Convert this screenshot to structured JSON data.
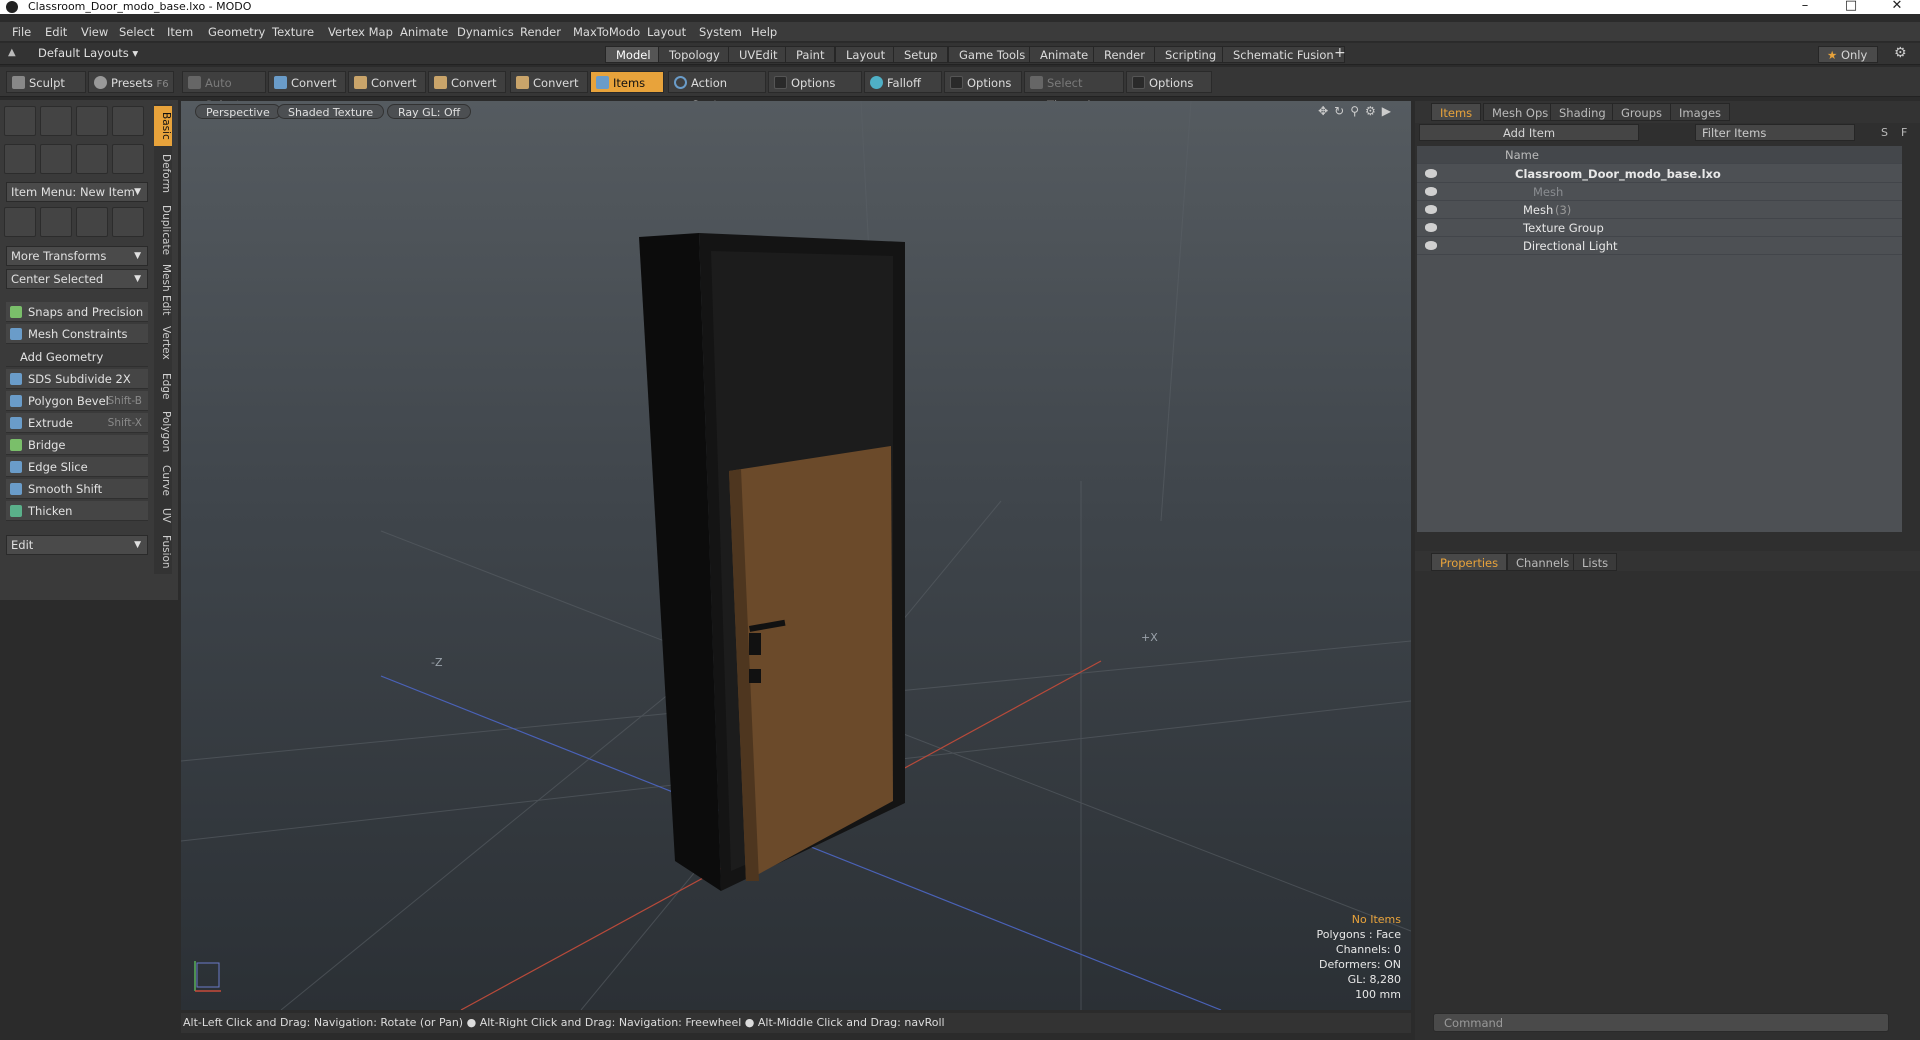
{
  "window": {
    "title": "Classroom_Door_modo_base.lxo - MODO"
  },
  "menu": [
    "File",
    "Edit",
    "View",
    "Select",
    "Item",
    "Geometry",
    "Texture",
    "Vertex Map",
    "Animate",
    "Dynamics",
    "Render",
    "MaxToModo",
    "Layout",
    "System",
    "Help"
  ],
  "layouts": {
    "preset": "Default Layouts",
    "tabs": [
      "Model",
      "Topology",
      "UVEdit",
      "Paint",
      "Layout",
      "Setup",
      "Game Tools",
      "Animate",
      "Render",
      "Scripting",
      "Schematic Fusion"
    ],
    "add": "+",
    "only": "Only"
  },
  "toolbar": {
    "sculpt": "Sculpt",
    "presets": "Presets",
    "presets_key": "F6",
    "auto_select": "Auto Select",
    "convert": "Convert",
    "items": "Items",
    "action_center": "Action Center",
    "options": "Options",
    "falloff": "Falloff",
    "select_through": "Select Through"
  },
  "left": {
    "item_menu": "Item Menu: New Item",
    "more_transforms": "More Transforms",
    "center_selected": "Center Selected",
    "snaps": "Snaps and Precision",
    "mesh_constraints": "Mesh Constraints",
    "add_geometry": "Add Geometry",
    "tools": [
      {
        "label": "SDS Subdivide 2X",
        "key": ""
      },
      {
        "label": "Polygon Bevel",
        "key": "Shift-B"
      },
      {
        "label": "Extrude",
        "key": "Shift-X"
      },
      {
        "label": "Bridge",
        "key": ""
      },
      {
        "label": "Edge Slice",
        "key": ""
      },
      {
        "label": "Smooth Shift",
        "key": ""
      },
      {
        "label": "Thicken",
        "key": ""
      }
    ],
    "edit": "Edit",
    "vtabs": [
      "Basic",
      "Deform",
      "Duplicate",
      "Mesh Edit",
      "Vertex",
      "Edge",
      "Polygon",
      "Curve",
      "UV",
      "Fusion"
    ]
  },
  "viewport": {
    "view": "Perspective",
    "shading": "Shaded Texture",
    "raygl": "Ray GL: Off",
    "info": {
      "items": "No Items",
      "polygons": "Polygons : Face",
      "channels": "Channels: 0",
      "deformers": "Deformers: ON",
      "gl": "GL: 8,280",
      "unit": "100 mm"
    },
    "axis_x": "+X",
    "axis_z": "-Z"
  },
  "status": "Alt-Left Click and Drag: Navigation: Rotate (or Pan) ● Alt-Right Click and Drag: Navigation: Freewheel ● Alt-Middle Click and Drag: navRoll",
  "items_panel": {
    "tabs": [
      "Items",
      "Mesh Ops",
      "Shading",
      "Groups",
      "Images"
    ],
    "add_item": "Add Item",
    "filter": "Filter Items",
    "s": "S",
    "f": "F",
    "name_col": "Name",
    "tree": [
      {
        "label": "Classroom_Door_modo_base.lxo",
        "count": ""
      },
      {
        "label": "Mesh",
        "count": ""
      },
      {
        "label": "Mesh",
        "count": "(3)"
      },
      {
        "label": "Texture Group",
        "count": ""
      },
      {
        "label": "Directional Light",
        "count": ""
      }
    ]
  },
  "props_panel": {
    "tabs": [
      "Properties",
      "Channels",
      "Lists"
    ]
  },
  "command": {
    "placeholder": "Command"
  },
  "colors": {
    "accent": "#e8a33b",
    "door_wood": "#6b4a2a",
    "frame": "#111111"
  }
}
